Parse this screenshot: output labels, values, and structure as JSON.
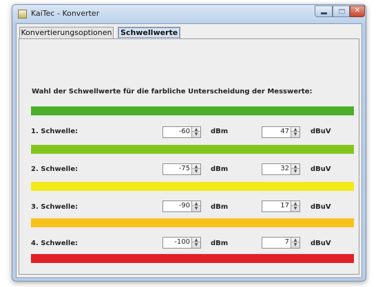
{
  "window": {
    "title": "KaiTec - Konverter"
  },
  "tabs": [
    {
      "label": "Konvertierungsoptionen"
    },
    {
      "label": "Schwellwerte"
    }
  ],
  "heading": "Wahl der Schwellwerte für die farbliche Unterscheidung der Messwerte:",
  "bars": {
    "colors": [
      "#4caf2a",
      "#84c41f",
      "#f2ea18",
      "#f7c21c",
      "#e02026"
    ]
  },
  "thresholds": [
    {
      "label": "1. Schwelle:",
      "dbm": "-60",
      "dbm_unit": "dBm",
      "dbuv": "47",
      "dbuv_unit": "dBuV"
    },
    {
      "label": "2. Schwelle:",
      "dbm": "-75",
      "dbm_unit": "dBm",
      "dbuv": "32",
      "dbuv_unit": "dBuV"
    },
    {
      "label": "3. Schwelle:",
      "dbm": "-90",
      "dbm_unit": "dBm",
      "dbuv": "17",
      "dbuv_unit": "dBuV"
    },
    {
      "label": "4. Schwelle:",
      "dbm": "-100",
      "dbm_unit": "dBm",
      "dbuv": "7",
      "dbuv_unit": "dBuV"
    }
  ]
}
